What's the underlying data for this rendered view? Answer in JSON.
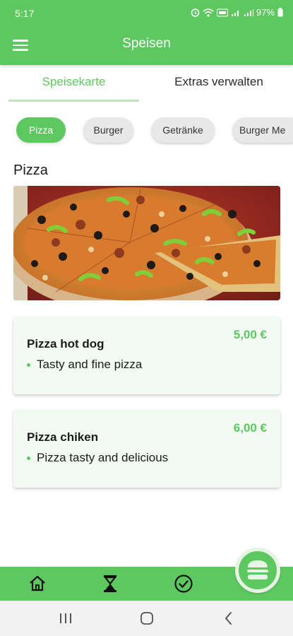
{
  "status_bar": {
    "time": "5:17",
    "battery": "97%"
  },
  "app_bar": {
    "title": "Speisen",
    "menu_icon": "menu-icon"
  },
  "tabs": [
    {
      "label": "Speisekarte",
      "active": true
    },
    {
      "label": "Extras verwalten",
      "active": false
    }
  ],
  "categories": [
    {
      "label": "Pizza",
      "active": true
    },
    {
      "label": "Burger",
      "active": false
    },
    {
      "label": "Getränke",
      "active": false
    },
    {
      "label": "Burger Me",
      "active": false
    }
  ],
  "section": {
    "title": "Pizza"
  },
  "products": [
    {
      "name": "Pizza hot dog",
      "description": "Tasty and fine pizza",
      "price": "5,00 €"
    },
    {
      "name": "Pizza chiken",
      "description": "Pizza tasty and delicious",
      "price": "6,00 €"
    }
  ],
  "bottom_nav": {
    "items": [
      "home-icon",
      "hourglass-icon",
      "check-circle-icon"
    ],
    "fab_icon": "burger-icon"
  },
  "colors": {
    "accent": "#5dc860",
    "accent_light": "#b9e6ba",
    "card_bg": "#f3faf3"
  }
}
